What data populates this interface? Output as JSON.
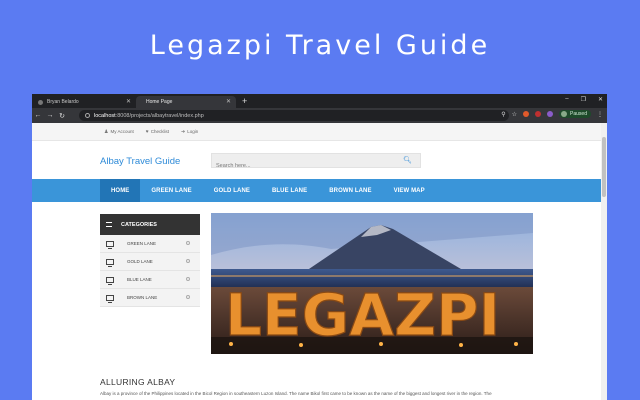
{
  "hero": {
    "title": "Legazpi Travel Guide"
  },
  "browser": {
    "tabs": [
      {
        "label": "Bryan Belardo"
      },
      {
        "label": "Home Page"
      }
    ],
    "url_host": "localhost",
    "url_path": ":8008/projects/albaytravel/index.php",
    "profile_status": "Paused"
  },
  "site": {
    "topbar": {
      "account": "My Account",
      "checklist": "Checklist",
      "login": "Login"
    },
    "brand": "Albay Travel Guide",
    "search": {
      "placeholder": "Search here..."
    },
    "nav": [
      "HOME",
      "GREEN LANE",
      "GOLD LANE",
      "BLUE LANE",
      "BROWN LANE",
      "VIEW MAP"
    ],
    "categories": {
      "heading": "CATEGORIES",
      "items": [
        "GREEN LANE",
        "GOLD LANE",
        "BLUE LANE",
        "BROWN LANE"
      ]
    },
    "banner_text": "LEGAZPI",
    "section": {
      "title": "ALLURING ALBAY",
      "text": "Albay is a province of the Philippines located in the Bicol Region in southeastern Luzon Island. The name Bikol first came to be known as the name of the biggest and longest river in the region. The"
    }
  },
  "colors": {
    "background": "#5b7bf2",
    "accent": "#3a95d9",
    "nav_active": "#2275b6",
    "brand": "#2f8bd8"
  }
}
